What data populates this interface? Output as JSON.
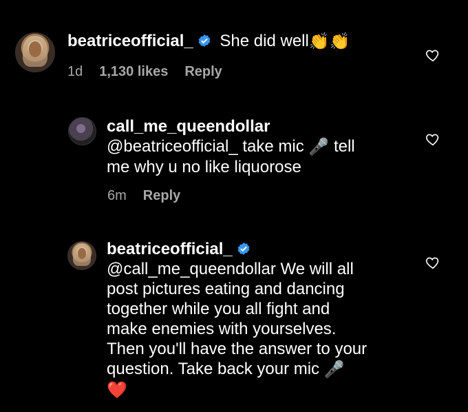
{
  "comments": [
    {
      "username": "beatriceofficial_",
      "verified": true,
      "text": "She did well",
      "emoji": "👏👏",
      "age": "1d",
      "likes": "1,130 likes",
      "reply_label": "Reply"
    },
    {
      "username": "call_me_queendollar",
      "verified": false,
      "mention": "@beatriceofficial_",
      "text_a": " take mic ",
      "mic_emoji": "🎤",
      "text_b": " tell",
      "text_line2": "me why u no like liquorose",
      "age": "6m",
      "reply_label": "Reply"
    },
    {
      "username": "beatriceofficial_",
      "verified": true,
      "mention": "@call_me_queendollar",
      "text_line1": " We will all",
      "text_line2": "post pictures eating and dancing",
      "text_line3": "together while you all fight and",
      "text_line4": "make enemies with yourselves.",
      "text_line5": "Then you'll have the answer to your",
      "text_line6": "question. Take back your mic ",
      "mic_emoji": "🎤",
      "heart_emoji": "❤️"
    }
  ],
  "colors": {
    "background": "#000000",
    "meta": "#a8a8a8",
    "verified": "#3897f0",
    "heart_emoji": "#e8253b"
  },
  "icons": [
    "like-heart-icon",
    "verified-badge-icon",
    "avatar-image"
  ]
}
